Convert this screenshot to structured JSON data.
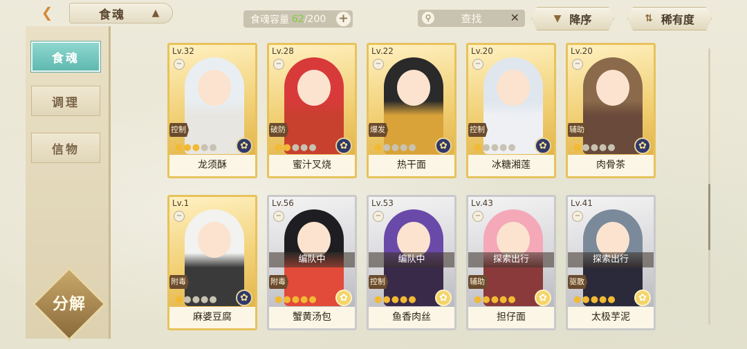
{
  "header": {
    "title": "食魂",
    "capacity_label": "食魂容量",
    "capacity_current": "62",
    "capacity_max": "/200",
    "search_label": "查找",
    "sort_label": "降序",
    "rarity_label": "稀有度"
  },
  "sidebar": {
    "tabs": [
      {
        "label": "食魂",
        "active": true
      },
      {
        "label": "调理",
        "active": false
      },
      {
        "label": "信物",
        "active": false
      }
    ],
    "decompose_label": "分解"
  },
  "cards": [
    {
      "level": "Lv.32",
      "name": "龙须酥",
      "role": "控制",
      "stars_on": 3,
      "stars_total": 5,
      "frame": "gold",
      "hair": "#e9eef2",
      "outfit": "#e8e6e0",
      "status": ""
    },
    {
      "level": "Lv.28",
      "name": "蜜汁叉烧",
      "role": "破防",
      "stars_on": 2,
      "stars_total": 5,
      "frame": "gold",
      "hair": "#d83a3a",
      "outfit": "#c8402e",
      "status": ""
    },
    {
      "level": "Lv.22",
      "name": "热干面",
      "role": "爆发",
      "stars_on": 1,
      "stars_total": 5,
      "frame": "gold",
      "hair": "#2a2a2a",
      "outfit": "#d9a33a",
      "status": ""
    },
    {
      "level": "Lv.20",
      "name": "冰糖湘莲",
      "role": "控制",
      "stars_on": 1,
      "stars_total": 5,
      "frame": "gold",
      "hair": "#dfe6ee",
      "outfit": "#eef0f4",
      "status": ""
    },
    {
      "level": "Lv.20",
      "name": "肉骨茶",
      "role": "辅助",
      "stars_on": 1,
      "stars_total": 5,
      "frame": "gold",
      "hair": "#8a6a4a",
      "outfit": "#6a4a3a",
      "status": ""
    },
    {
      "level": "Lv.1",
      "name": "麻婆豆腐",
      "role": "附毒",
      "stars_on": 1,
      "stars_total": 5,
      "frame": "gold",
      "hair": "#f2f2f0",
      "outfit": "#3a3a3a",
      "status": ""
    },
    {
      "level": "Lv.56",
      "name": "蟹黄汤包",
      "role": "附毒",
      "stars_on": 5,
      "stars_total": 5,
      "frame": "silver",
      "hair": "#1e1e22",
      "outfit": "#e24a3a",
      "status": "编队中"
    },
    {
      "level": "Lv.53",
      "name": "鱼香肉丝",
      "role": "控制",
      "stars_on": 5,
      "stars_total": 5,
      "frame": "silver",
      "hair": "#6a4aa8",
      "outfit": "#3a2a4a",
      "status": "编队中"
    },
    {
      "level": "Lv.43",
      "name": "担仔面",
      "role": "辅助",
      "stars_on": 5,
      "stars_total": 5,
      "frame": "silver",
      "hair": "#f4a8b8",
      "outfit": "#8a3a3a",
      "status": "探索出行"
    },
    {
      "level": "Lv.41",
      "name": "太极芋泥",
      "role": "驱散",
      "stars_on": 5,
      "stars_total": 5,
      "frame": "silver",
      "hair": "#7a8a9a",
      "outfit": "#2a2a3a",
      "status": "探索出行"
    }
  ],
  "colors": {
    "accent_teal": "#6fc6bd",
    "gold_frame": "#e7c25c",
    "silver_frame": "#c9c9cc",
    "capacity_current": "#7fcf3a"
  }
}
